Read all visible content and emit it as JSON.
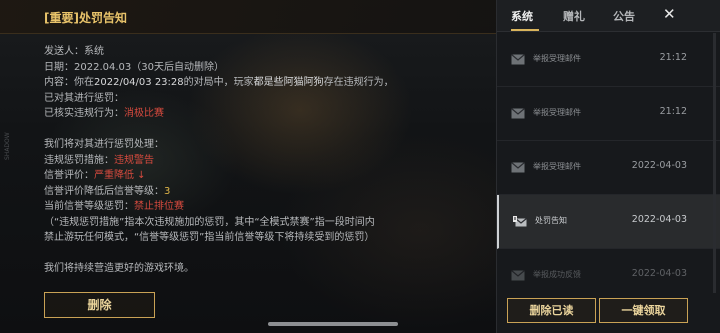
{
  "notice": {
    "header": "[重要]处罚告知",
    "sender": "发送人：系统",
    "date": "日期：2022.04.03（30天后自动删除）",
    "body_line1_prefix": "内容：你在",
    "body_line1_time": "2022/04/03 23:28",
    "body_line1_mid": "的对局中，玩家",
    "body_line1_player": "都是些阿猫阿狗",
    "body_line1_suffix": "存在违规行为，",
    "body_line2": "已对其进行惩罚：",
    "verified_label": "已核实违规行为：",
    "verified_value": "消极比赛",
    "punish_intro": "我们将对其进行惩罚处理：",
    "measure_label": "违规惩罚措施：",
    "measure_value": "违规警告",
    "credit_label": "信誉评价：",
    "credit_value": "严重降低 ↓",
    "level_label": "信誉评价降低后信誉等级：",
    "level_value": "3",
    "current_label": "当前信誉等级惩罚：",
    "current_value": "禁止排位赛",
    "note_line1": "（“违规惩罚措施”指本次违规施加的惩罚，其中“全模式禁赛”指一段时间内",
    "note_line2": "禁止游玩任何模式，“信誉等级惩罚”指当前信誉等级下将持续受到的惩罚）",
    "closing": "我们将持续营造更好的游戏环境。",
    "delete_label": "删除"
  },
  "sidebar": {
    "tabs": [
      "系统",
      "赠礼",
      "公告"
    ],
    "active_tab": 0,
    "close_symbol": "✕",
    "items": [
      {
        "title": "举报受理邮件",
        "time": "21:12"
      },
      {
        "title": "举报受理邮件",
        "time": "21:12"
      },
      {
        "title": "举报受理邮件",
        "time": "2022-04-03"
      },
      {
        "title": "处罚告知",
        "time": "2022-04-03",
        "selected": true
      },
      {
        "title": "举报成功反馈",
        "time": "2022-04-03"
      }
    ],
    "delete_read_label": "删除已读",
    "claim_all_label": "一键领取"
  },
  "edge_text": "SHADOW",
  "colors": {
    "accent_gold": "#e8c36a",
    "warning_red": "#d64a3e",
    "level_yellow": "#e0b648"
  }
}
